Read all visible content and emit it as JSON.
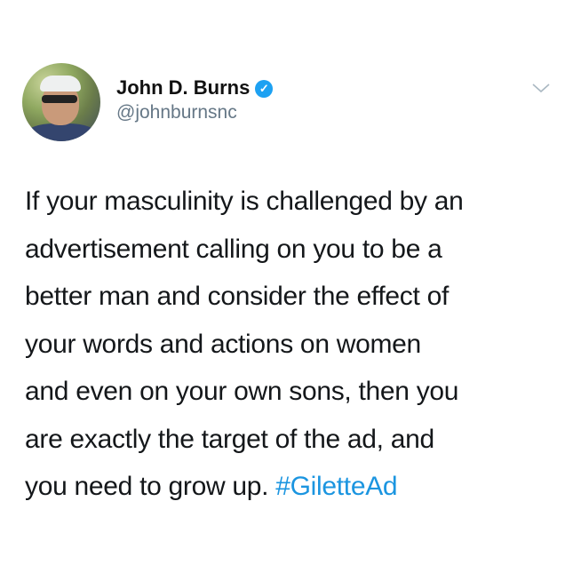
{
  "tweet": {
    "author_name": "John D. Burns",
    "verified": true,
    "handle": "@johnburnsnc",
    "lines": [
      "If your masculinity is challenged by an",
      "advertisement calling on you to be a",
      "better man and consider the effect of",
      "your words and actions on women",
      "and even on your own sons, then you",
      "are exactly the target of the ad, and",
      "you need to grow up. "
    ],
    "hashtag": "#GiletteAd",
    "hashtag_color": "#1b95e0",
    "verified_color": "#1da1f2",
    "icons": {
      "verified": "verified-badge-icon",
      "menu": "chevron-down-icon"
    }
  }
}
